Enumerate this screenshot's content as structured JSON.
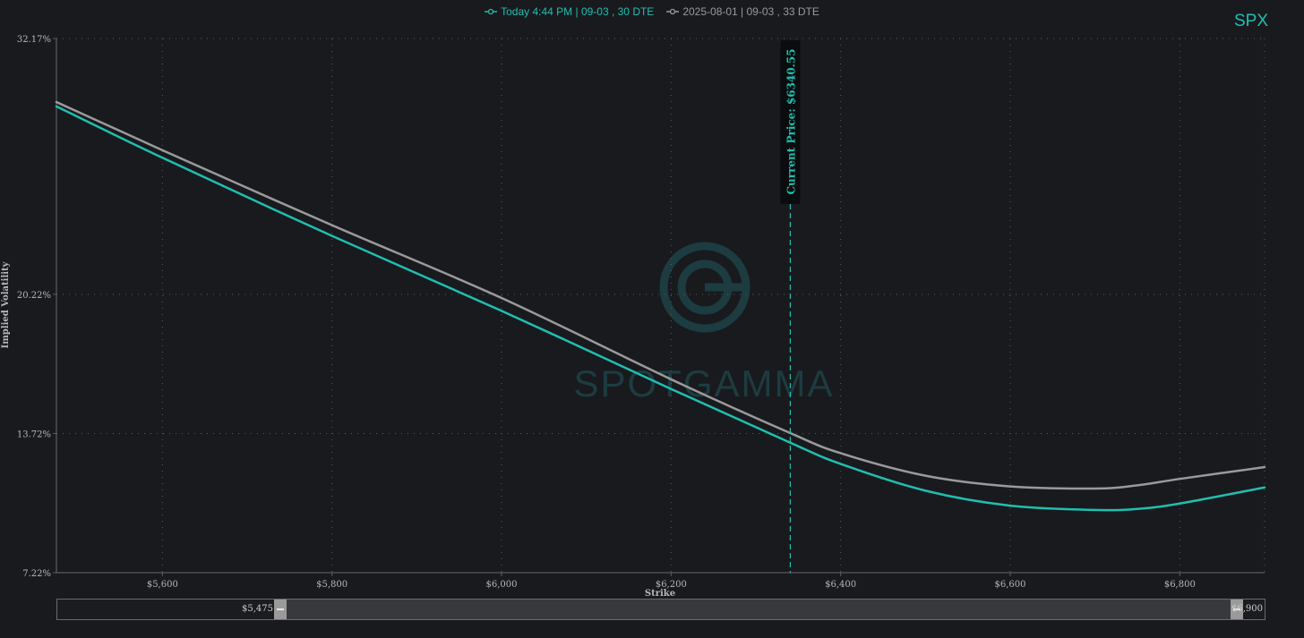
{
  "ticker": "SPX",
  "colors": {
    "background": "#191a1e",
    "today": "#1fbfb0",
    "previous": "#9a9a9a",
    "axis_text": "#b8b8b8",
    "grid": "#5a5b60",
    "watermark": "#1c3c40"
  },
  "watermark_text": "SPOTGAMMA",
  "slider": {
    "min_label": "$5,475",
    "max_label": "$6,900"
  },
  "chart_data": {
    "type": "line",
    "xlabel": "Strike",
    "ylabel": "Implied Volatility",
    "xlim": [
      5475,
      6900
    ],
    "ylim": [
      7.22,
      32.17
    ],
    "x_ticks": [
      5600,
      5800,
      6000,
      6200,
      6400,
      6600,
      6800
    ],
    "x_tick_labels": [
      "$5,600",
      "$5,800",
      "$6,000",
      "$6,200",
      "$6,400",
      "$6,600",
      "$6,800"
    ],
    "y_ticks": [
      7.22,
      13.72,
      20.22,
      32.17
    ],
    "y_tick_labels": [
      "7.22%",
      "13.72%",
      "20.22%",
      "32.17%"
    ],
    "grid": true,
    "legend_position": "top-center",
    "current_price": {
      "value": 6340.55,
      "label": "Current Price: $6340.55"
    },
    "series": [
      {
        "name": "Today 4:44 PM | 09-03 , 30 DTE",
        "color": "#1fbfb0",
        "x": [
          5475,
          5600,
          5800,
          6000,
          6200,
          6340,
          6400,
          6500,
          6600,
          6700,
          6750,
          6800,
          6900
        ],
        "y": [
          29.0,
          26.6,
          22.95,
          19.45,
          15.8,
          13.3,
          12.3,
          11.05,
          10.35,
          10.15,
          10.2,
          10.45,
          11.2
        ]
      },
      {
        "name": "2025-08-01 | 09-03 , 33 DTE",
        "color": "#9a9a9a",
        "x": [
          5475,
          5600,
          5800,
          6000,
          6200,
          6340,
          6400,
          6500,
          6600,
          6700,
          6750,
          6800,
          6900
        ],
        "y": [
          29.2,
          26.95,
          23.45,
          20.05,
          16.25,
          13.75,
          12.8,
          11.75,
          11.25,
          11.15,
          11.3,
          11.6,
          12.15
        ]
      }
    ]
  }
}
